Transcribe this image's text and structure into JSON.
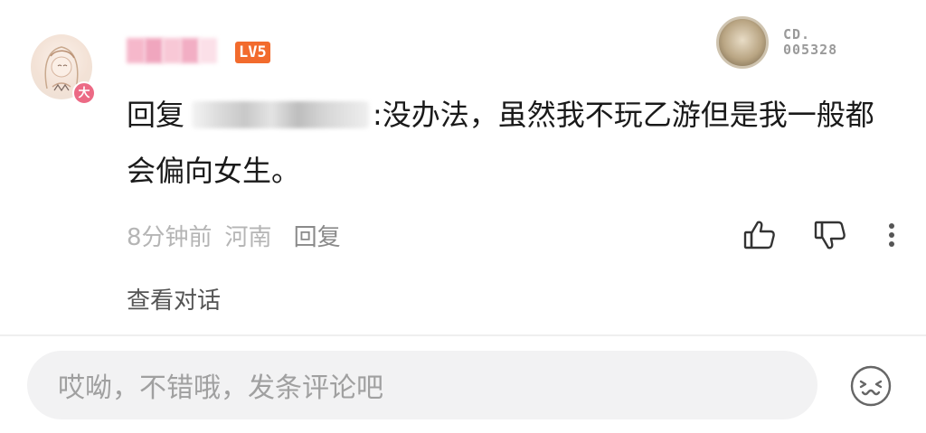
{
  "comment": {
    "avatar_badge": "大",
    "level": "LV5",
    "medal_label": "CD.\n005328",
    "reply_prefix": "回复",
    "text_after_name": ":没办法，虽然我不玩乙游但是我一般都会偏向女生。",
    "time": "8分钟前",
    "location": "河南",
    "reply_label": "回复",
    "view_conversation": "查看对话"
  },
  "icons": {
    "like": "thumbs-up-icon",
    "dislike": "thumbs-down-icon",
    "more": "more-vertical-icon",
    "emoji": "emoji-face-icon"
  },
  "input": {
    "placeholder": "哎呦，不错哦，发条评论吧"
  },
  "colors": {
    "level_badge": "#f26b2d",
    "avatar_badge": "#ec6a85",
    "input_bg": "#f2f2f3"
  }
}
